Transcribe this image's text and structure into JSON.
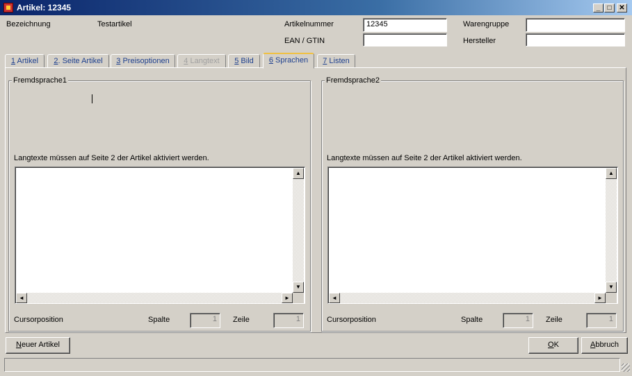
{
  "window": {
    "title": "Artikel: 12345",
    "controls": [
      "_",
      "□",
      "✕"
    ]
  },
  "header": {
    "bezeichnung_label": "Bezeichnung",
    "bezeichnung_value": "Testartikel",
    "artikelnummer_label": "Artikelnummer",
    "artikelnummer_value": "12345",
    "ean_label": "EAN / GTIN",
    "ean_value": "",
    "warengruppe_label": "Warengruppe",
    "warengruppe_value": "",
    "hersteller_label": "Hersteller",
    "hersteller_value": ""
  },
  "tabs": [
    {
      "key": "1",
      "label": " Artikel",
      "state": "normal"
    },
    {
      "key": "2",
      "label": ". Seite Artikel",
      "state": "normal"
    },
    {
      "key": "3",
      "label": " Preisoptionen",
      "state": "normal"
    },
    {
      "key": "4",
      "label": " Langtext",
      "state": "disabled"
    },
    {
      "key": "5",
      "label": " Bild",
      "state": "normal"
    },
    {
      "key": "6",
      "label": " Sprachen",
      "state": "active"
    },
    {
      "key": "7",
      "label": " Listen",
      "state": "normal"
    }
  ],
  "lang1": {
    "title": "Fremdsprache1",
    "note": "Langtexte müssen auf Seite 2 der Artikel aktiviert werden.",
    "text": "",
    "cursor_label": "Cursorposition",
    "spalte_label": "Spalte",
    "spalte_value": "1",
    "zeile_label": "Zeile",
    "zeile_value": "1"
  },
  "lang2": {
    "title": "Fremdsprache2",
    "note": "Langtexte müssen auf Seite 2 der Artikel aktiviert werden.",
    "text": "",
    "cursor_label": "Cursorposition",
    "spalte_label": "Spalte",
    "spalte_value": "1",
    "zeile_label": "Zeile",
    "zeile_value": "1"
  },
  "buttons": {
    "new_key": "N",
    "new_rest": "euer Artikel",
    "ok_key": "O",
    "ok_rest": "K",
    "cancel_key": "A",
    "cancel_rest": "bbruch"
  },
  "status": {
    "text": ""
  },
  "icons": {
    "scroll_up": "▲",
    "scroll_down": "▼",
    "scroll_left": "◄",
    "scroll_right": "►"
  }
}
